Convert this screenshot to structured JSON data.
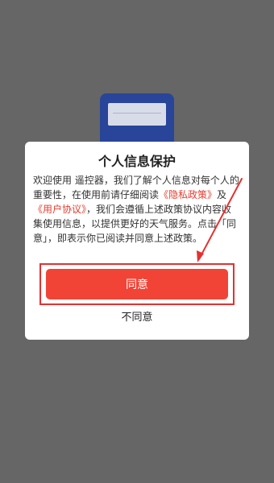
{
  "dialog": {
    "title": "个人信息保护",
    "text_1": "欢迎使用 遥控器，我们了解个人信息对每个人的重要性，在使用前请仔细阅读",
    "privacy_link": "《隐私政策》",
    "conjunction": "及",
    "terms_link": "《用户协议》",
    "text_2": "，我们会遵循上述政策协议内容收集使用信息，以提供更好的天气服务。点击「同意」，即表示你已阅读并同意上述政策。",
    "agree_label": "同意",
    "disagree_label": "不同意"
  },
  "colors": {
    "overlay": "#666666",
    "accent": "#f24436",
    "link": "#e53d2f",
    "annotation": "#e53030",
    "device": "#28459a"
  }
}
